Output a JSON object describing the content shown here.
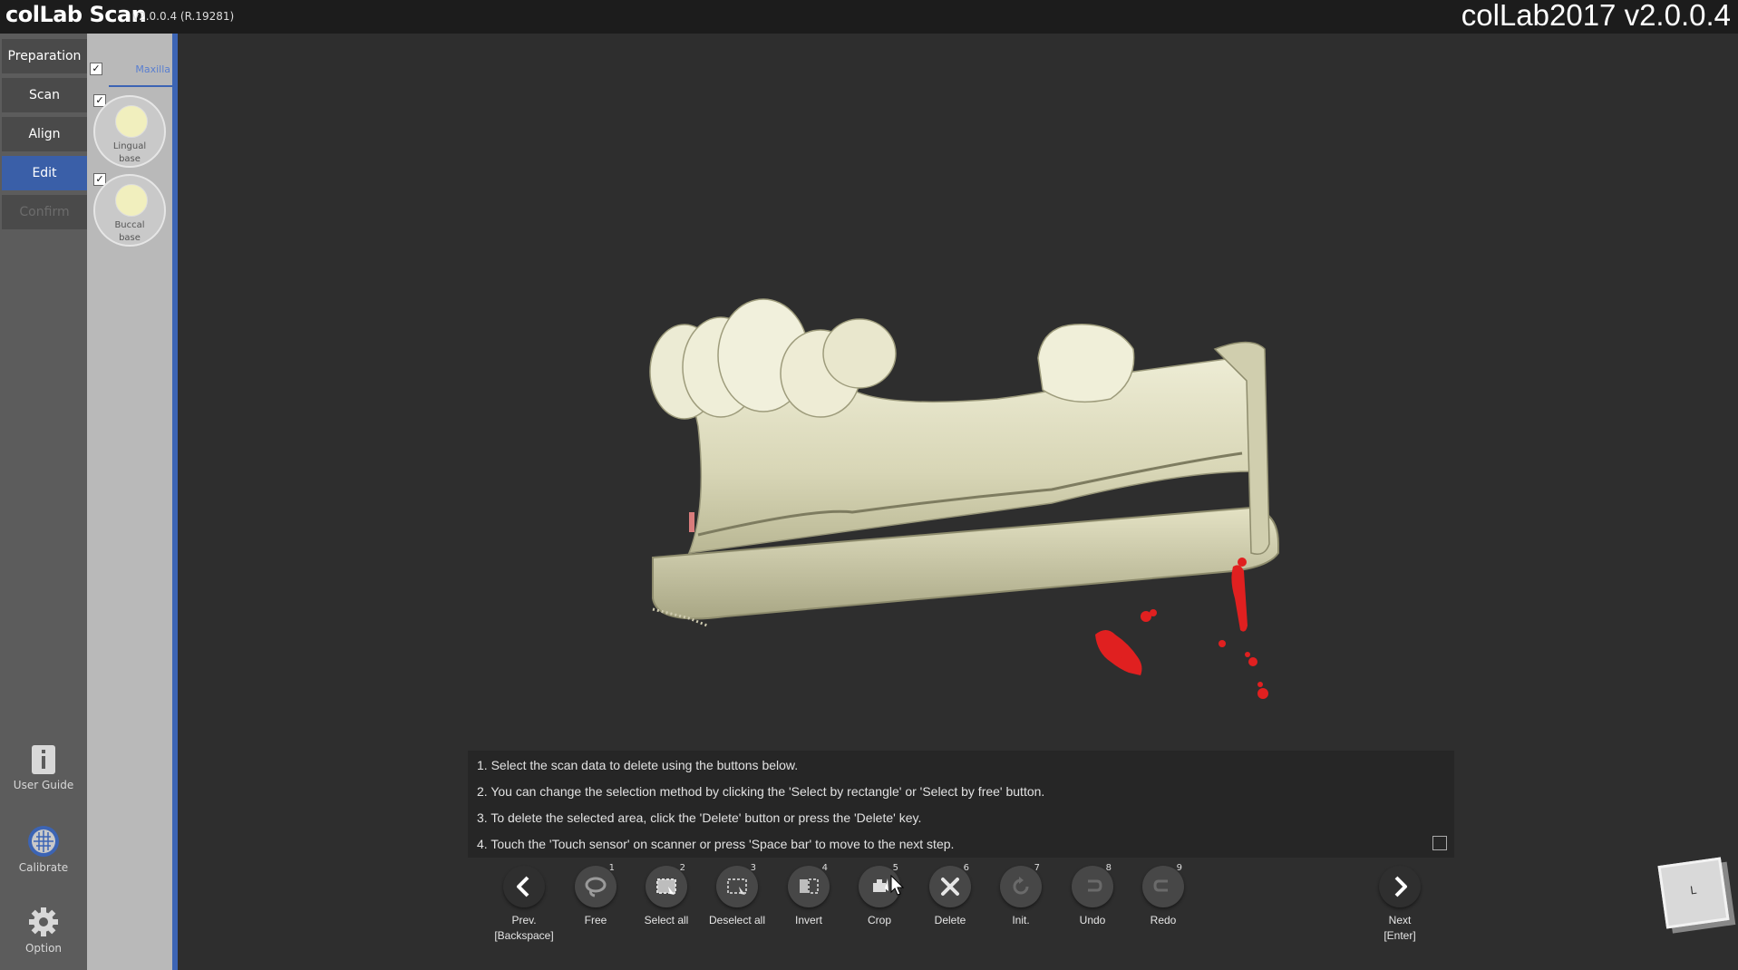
{
  "titlebar": {
    "app_title": "colLab Scan",
    "version": "v2.0.0.4  (R.19281)",
    "brand": "colLab2017 v2.0.0.4"
  },
  "nav": {
    "items": [
      {
        "label": "Preparation",
        "state": "normal"
      },
      {
        "label": "Scan",
        "state": "normal"
      },
      {
        "label": "Align",
        "state": "normal"
      },
      {
        "label": "Edit",
        "state": "active"
      },
      {
        "label": "Confirm",
        "state": "disabled"
      }
    ],
    "tools": {
      "user_guide": "User Guide",
      "calibrate": "Calibrate",
      "option": "Option"
    }
  },
  "scan_list": {
    "group_label": "Maxilla",
    "group_checked": true,
    "items": [
      {
        "line1": "Lingual",
        "line2": "base",
        "checked": true
      },
      {
        "line1": "Buccal",
        "line2": "base",
        "checked": true
      }
    ]
  },
  "instructions": [
    "1. Select the scan data to delete using the buttons below.",
    "2. You can change the selection method by clicking the 'Select by rectangle' or 'Select by free' button.",
    "3. To delete the selected area, click the 'Delete' button or press the 'Delete' key.",
    "4. Touch the 'Touch sensor' on scanner or press 'Space bar' to move to the next step."
  ],
  "toolbar": {
    "prev": {
      "line1": "Prev.",
      "line2": "[Backspace]"
    },
    "next": {
      "line1": "Next",
      "line2": "[Enter]"
    },
    "buttons": [
      {
        "label": "Free",
        "num": "1",
        "icon": "lasso-icon"
      },
      {
        "label": "Select all",
        "num": "2",
        "icon": "select-all-icon"
      },
      {
        "label": "Deselect all",
        "num": "3",
        "icon": "deselect-all-icon"
      },
      {
        "label": "Invert",
        "num": "4",
        "icon": "invert-icon"
      },
      {
        "label": "Crop",
        "num": "5",
        "icon": "crop-icon"
      },
      {
        "label": "Delete",
        "num": "6",
        "icon": "delete-icon"
      },
      {
        "label": "Init.",
        "num": "7",
        "icon": "init-icon"
      },
      {
        "label": "Undo",
        "num": "8",
        "icon": "undo-icon"
      },
      {
        "label": "Redo",
        "num": "9",
        "icon": "redo-icon"
      }
    ]
  },
  "orientation_cube": {
    "face": "L"
  },
  "colors": {
    "accent": "#3a5fa8",
    "model": "#e3e1c6",
    "selection": "#e02020"
  }
}
